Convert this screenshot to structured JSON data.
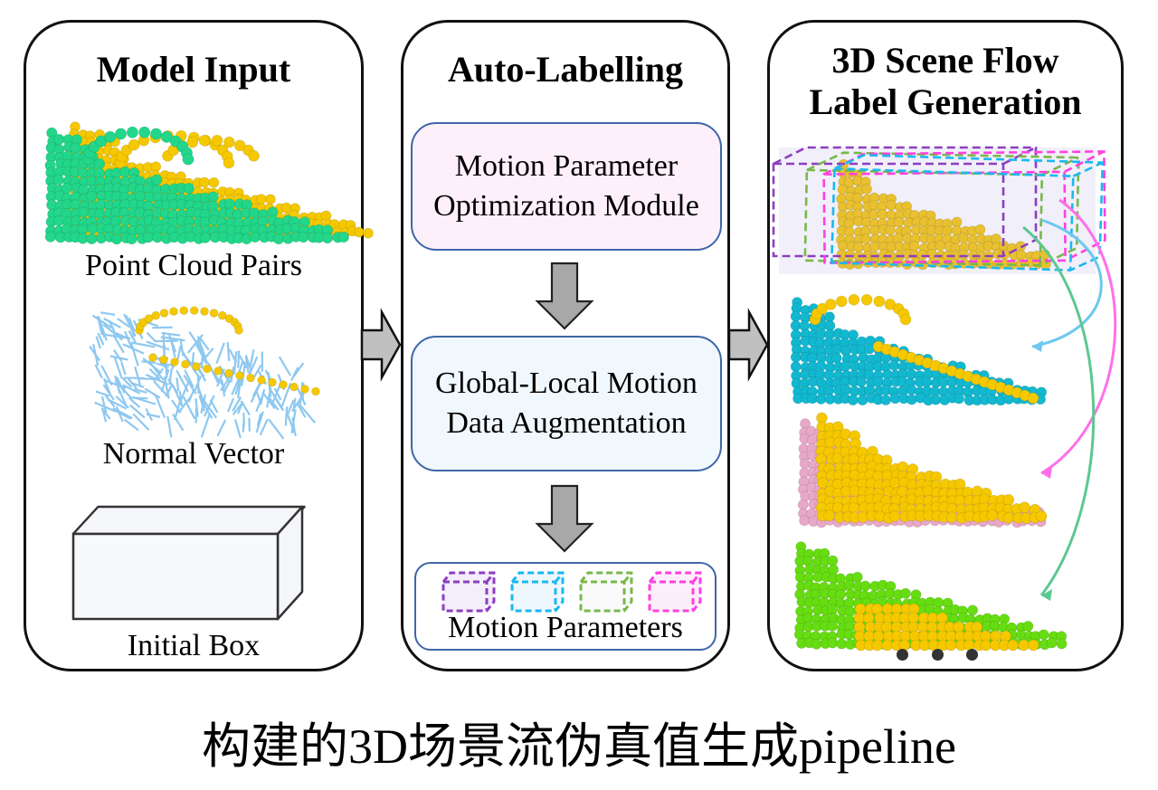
{
  "panels": {
    "model_input": {
      "title": "Model Input",
      "items": [
        "Point Cloud Pairs",
        "Normal Vector",
        "Initial Box"
      ]
    },
    "auto_labelling": {
      "title": "Auto-Labelling",
      "modules": [
        {
          "line1": "Motion Parameter",
          "line2": "Optimization Module"
        },
        {
          "line1": "Global-Local Motion",
          "line2": "Data Augmentation"
        }
      ],
      "params_label": "Motion Parameters"
    },
    "label_generation": {
      "title_line1": "3D Scene Flow",
      "title_line2": "Label Generation",
      "ellipsis": "• • •"
    }
  },
  "colors": {
    "panel_border": "#111111",
    "module_border": "#3f66a8",
    "module1_fill": "#fdf0fb",
    "module2_fill": "#f1f8fd",
    "arrow_fill": "#a8a8a8",
    "point_yellow": "#f5c800",
    "point_green": "#22d68a",
    "point_cyan": "#12b8d0",
    "point_pink": "#e8a8c8",
    "point_lime": "#66dd11",
    "normal_blue": "#8ec8f0",
    "box_purple": "#8c3fc0",
    "box_cyan": "#1ab8f0",
    "box_green": "#78b84a",
    "box_magenta": "#ff40e0",
    "curve_cyan": "#6cc8f0",
    "curve_magenta": "#ff70e8",
    "curve_green": "#5cc890"
  },
  "caption": "构建的3D场景流伪真值生成pipeline"
}
